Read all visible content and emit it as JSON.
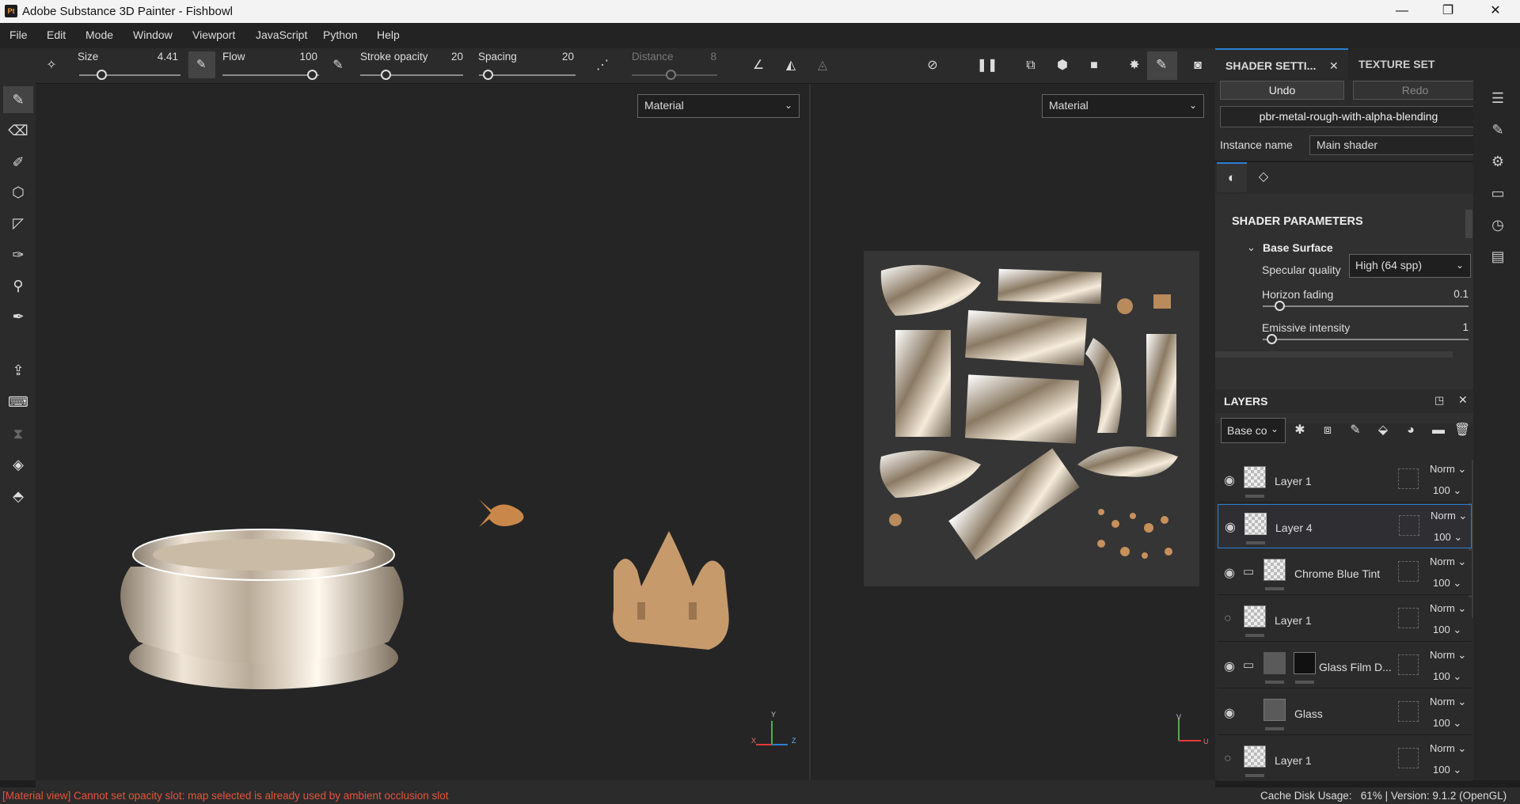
{
  "window": {
    "logo": "Pt",
    "title": "Adobe Substance 3D Painter - Fishbowl",
    "minimize": "—",
    "maximize": "❐",
    "close": "✕"
  },
  "menu": [
    "File",
    "Edit",
    "Mode",
    "Window",
    "Viewport",
    "JavaScript",
    "Python",
    "Help"
  ],
  "toolbar": {
    "size_label": "Size",
    "size_value": "4.41",
    "flow_label": "Flow",
    "flow_value": "100",
    "stroke_opacity_label": "Stroke opacity",
    "stroke_opacity_value": "20",
    "spacing_label": "Spacing",
    "spacing_value": "20",
    "distance_label": "Distance",
    "distance_value": "8"
  },
  "viewport": {
    "left_mode": "Material",
    "right_mode": "Material",
    "axis_y": "Y",
    "axis_x": "X",
    "axis_z": "Z",
    "uv_v": "V",
    "uv_u": "U"
  },
  "shader_panel": {
    "tab_active": "SHADER SETTI...",
    "tab_inactive": "TEXTURE SET SETTIN...",
    "undo": "Undo",
    "redo": "Redo",
    "shader_name": "pbr-metal-rough-with-alpha-blending",
    "instance_label": "Instance name",
    "instance_value": "Main shader",
    "section_title": "SHADER PARAMETERS",
    "group": "Base Surface",
    "specular_label": "Specular quality",
    "specular_value": "High (64 spp)",
    "horizon_label": "Horizon fading",
    "horizon_value": "0.1",
    "emissive_label": "Emissive intensity",
    "emissive_value": "1"
  },
  "layers_panel": {
    "title": "LAYERS",
    "channel_select": "Base co",
    "layers": [
      {
        "name": "Layer 1",
        "blend": "Norm",
        "opacity": "100",
        "visible": true,
        "selected": false
      },
      {
        "name": "Layer 4",
        "blend": "Norm",
        "opacity": "100",
        "visible": true,
        "selected": true
      },
      {
        "name": "Chrome Blue Tint",
        "blend": "Norm",
        "opacity": "100",
        "visible": true,
        "selected": false
      },
      {
        "name": "Layer 1",
        "blend": "Norm",
        "opacity": "100",
        "visible": false,
        "selected": false
      },
      {
        "name": "Glass Film D...",
        "blend": "Norm",
        "opacity": "100",
        "visible": true,
        "selected": false
      },
      {
        "name": "Glass",
        "blend": "Norm",
        "opacity": "100",
        "visible": true,
        "selected": false
      },
      {
        "name": "Layer 1",
        "blend": "Norm",
        "opacity": "100",
        "visible": false,
        "selected": false
      }
    ]
  },
  "status": {
    "message": "[Material view] Cannot set opacity slot: map selected is already used by ambient occlusion slot",
    "cache": "Cache Disk Usage:   61% | Version: 9.1.2 (OpenGL)"
  },
  "colors": {
    "accent": "#2d7fd3",
    "error_text": "#e8523c",
    "panel": "#2b2b2b",
    "viewport": "#252525"
  }
}
